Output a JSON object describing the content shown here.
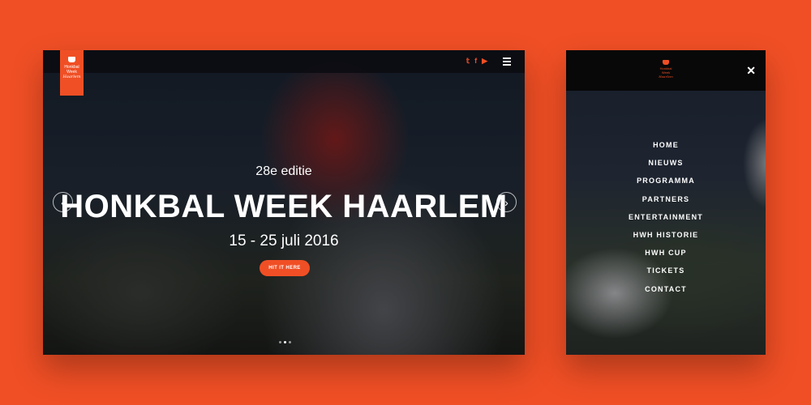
{
  "desktop": {
    "logo": {
      "line1": "Honkbal",
      "line2": "Week",
      "line3": "Haarlem"
    },
    "social_icons": [
      {
        "name": "twitter-icon",
        "glyph": "𝕥"
      },
      {
        "name": "facebook-icon",
        "glyph": "f"
      },
      {
        "name": "youtube-icon",
        "glyph": "▶"
      }
    ],
    "hero": {
      "edition": "28e editie",
      "title": "HONKBAL WEEK HAARLEM",
      "dates": "15 - 25 juli 2016",
      "cta_label": "HIT IT HERE"
    },
    "arrows": {
      "prev": "‹",
      "next": "›"
    },
    "slide_count": 3,
    "active_slide": 2
  },
  "mobile": {
    "logo": {
      "line1": "Honkbal",
      "line2": "Week",
      "line3": "Haarlem"
    },
    "close_glyph": "✕",
    "menu": [
      "HOME",
      "NIEUWS",
      "PROGRAMMA",
      "PARTNERS",
      "ENTERTAINMENT",
      "HWH HISTORIE",
      "HWH CUP",
      "TICKETS",
      "CONTACT"
    ]
  },
  "colors": {
    "accent": "#f04f25",
    "background": "#f04f25",
    "bar": "#080808"
  }
}
